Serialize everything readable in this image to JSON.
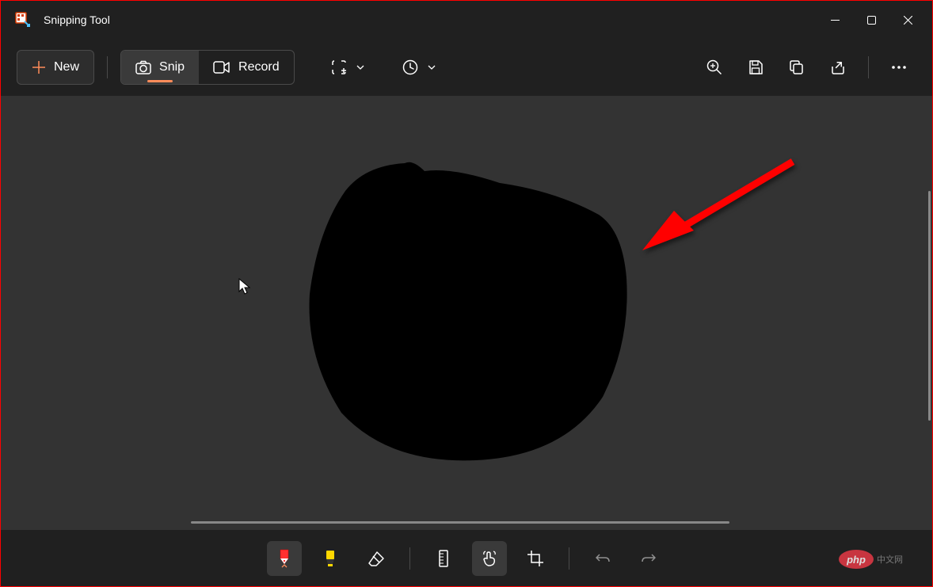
{
  "titlebar": {
    "app_name": "Snipping Tool"
  },
  "toolbar": {
    "new_label": "New",
    "snip_label": "Snip",
    "record_label": "Record",
    "mode_icon": "snip-mode-icon",
    "delay_icon": "delay-icon",
    "zoom_icon": "zoom-icon",
    "save_icon": "save-icon",
    "copy_icon": "copy-icon",
    "share_icon": "share-icon",
    "more_icon": "more-icon"
  },
  "bottombar": {
    "tools": [
      "pen-tool",
      "highlighter-tool",
      "eraser-tool",
      "ruler-tool",
      "touch-writing-tool",
      "crop-tool",
      "undo-tool",
      "redo-tool"
    ],
    "active_tool": "pen-tool"
  },
  "canvas": {
    "content": "black-blob-drawing",
    "annotation": "red-arrow"
  },
  "watermark": {
    "text": "php",
    "subtext": "中文网"
  }
}
